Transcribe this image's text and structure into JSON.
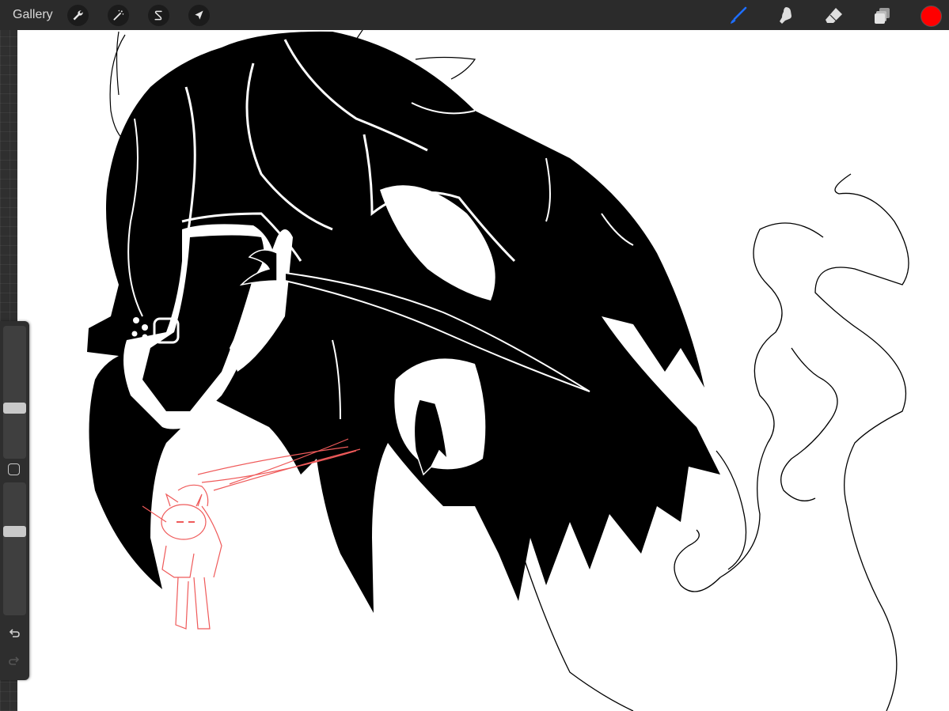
{
  "toolbar": {
    "gallery_label": "Gallery",
    "left_tools": [
      "wrench-icon",
      "magic-wand-icon",
      "selection-s-icon",
      "transform-arrow-icon"
    ],
    "right_tools": [
      "brush-icon",
      "smudge-icon",
      "eraser-icon",
      "layers-icon"
    ],
    "current_color": "#ff0000",
    "active_tool_color": "#1e6fff"
  },
  "sidebar": {
    "brush_size_level": 0.37,
    "opacity_level": 0.64,
    "controls": [
      "brush-size-slider",
      "modify-button",
      "opacity-slider",
      "undo-button",
      "redo-button"
    ]
  },
  "canvas": {
    "background": "#ffffff",
    "ink_color": "#000000",
    "sketch_color": "#ef5a5a"
  }
}
